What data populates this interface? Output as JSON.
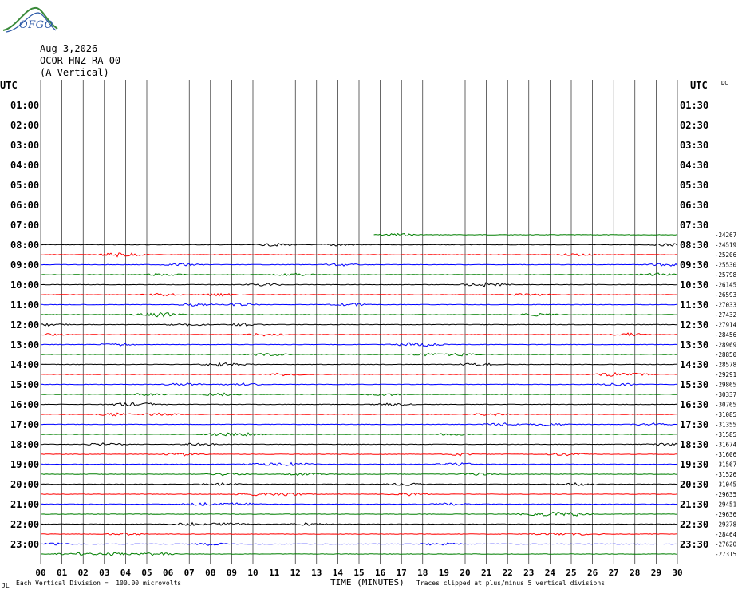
{
  "header": {
    "date": "Aug 3,2026",
    "station": "OCOR HNZ RA 00",
    "component": "(A Vertical)",
    "logo_text": "OFGO",
    "utc_left": "UTC",
    "utc_right": "UTC",
    "dc_label": "DC"
  },
  "footer": {
    "scale_note": "Each Vertical Division =  100.00 microvolts",
    "corner_mark": "JL",
    "clip_note": "Traces clipped at plus/minus 5 vertical divisions"
  },
  "colors": {
    "black": "#000000",
    "red": "#ff0000",
    "blue": "#0000ff",
    "green": "#007f00",
    "grid": "#000000"
  },
  "chart_data": {
    "type": "line",
    "title": "",
    "xlabel": "TIME (MINUTES)",
    "x_ticks": [
      "00",
      "01",
      "02",
      "03",
      "04",
      "05",
      "06",
      "07",
      "08",
      "09",
      "10",
      "11",
      "12",
      "13",
      "14",
      "15",
      "16",
      "17",
      "18",
      "19",
      "20",
      "21",
      "22",
      "23",
      "24",
      "25",
      "26",
      "27",
      "28",
      "29",
      "30"
    ],
    "xlim": [
      0,
      30
    ],
    "left_hour_labels": [
      "01:00",
      "02:00",
      "03:00",
      "04:00",
      "05:00",
      "06:00",
      "07:00",
      "08:00",
      "09:00",
      "10:00",
      "11:00",
      "12:00",
      "13:00",
      "14:00",
      "15:00",
      "16:00",
      "17:00",
      "18:00",
      "19:00",
      "20:00",
      "21:00",
      "22:00",
      "23:00"
    ],
    "right_hour_labels": [
      "01:30",
      "02:30",
      "03:30",
      "04:30",
      "05:30",
      "06:30",
      "07:30",
      "08:30",
      "09:30",
      "10:30",
      "11:30",
      "12:30",
      "13:30",
      "14:30",
      "15:30",
      "16:30",
      "17:30",
      "18:30",
      "19:30",
      "20:30",
      "21:30",
      "22:30",
      "23:30"
    ],
    "dc_values": [
      "-24267",
      "-24519",
      "-25206",
      "-25530",
      "-25798",
      "-26145",
      "-26593",
      "-27033",
      "-27432",
      "-27914",
      "-28456",
      "-28969",
      "-28850",
      "-28578",
      "-29291",
      "-29865",
      "-30337",
      "-30765",
      "-31085",
      "-31355",
      "-31585",
      "-31674",
      "-31606",
      "-31567",
      "-31526",
      "-31045",
      "-29635",
      "-29451",
      "-29636",
      "-29378",
      "-28464",
      "-27620",
      "-27315"
    ],
    "traces": [
      {
        "start_min": 15.7,
        "color": "green"
      },
      {
        "start_min": 0,
        "color": "black"
      },
      {
        "start_min": 0,
        "color": "red"
      },
      {
        "start_min": 0,
        "color": "blue"
      },
      {
        "start_min": 0,
        "color": "green"
      },
      {
        "start_min": 0,
        "color": "black"
      },
      {
        "start_min": 0,
        "color": "red"
      },
      {
        "start_min": 0,
        "color": "blue"
      },
      {
        "start_min": 0,
        "color": "green"
      },
      {
        "start_min": 0,
        "color": "black"
      },
      {
        "start_min": 0,
        "color": "red"
      },
      {
        "start_min": 0,
        "color": "blue"
      },
      {
        "start_min": 0,
        "color": "green"
      },
      {
        "start_min": 0,
        "color": "black"
      },
      {
        "start_min": 0,
        "color": "red"
      },
      {
        "start_min": 0,
        "color": "blue"
      },
      {
        "start_min": 0,
        "color": "green"
      },
      {
        "start_min": 0,
        "color": "black"
      },
      {
        "start_min": 0,
        "color": "red"
      },
      {
        "start_min": 0,
        "color": "blue"
      },
      {
        "start_min": 0,
        "color": "green"
      },
      {
        "start_min": 0,
        "color": "black"
      },
      {
        "start_min": 0,
        "color": "red"
      },
      {
        "start_min": 0,
        "color": "blue"
      },
      {
        "start_min": 0,
        "color": "green"
      },
      {
        "start_min": 0,
        "color": "black"
      },
      {
        "start_min": 0,
        "color": "red"
      },
      {
        "start_min": 0,
        "color": "blue"
      },
      {
        "start_min": 0,
        "color": "green"
      },
      {
        "start_min": 0,
        "color": "black"
      },
      {
        "start_min": 0,
        "color": "red"
      },
      {
        "start_min": 0,
        "color": "blue"
      },
      {
        "start_min": 0,
        "color": "green"
      }
    ]
  }
}
